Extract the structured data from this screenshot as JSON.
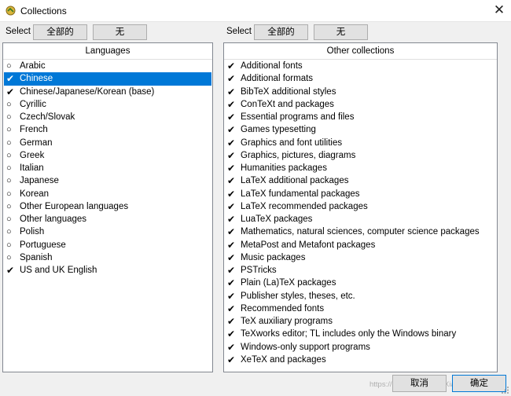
{
  "window": {
    "title": "Collections",
    "close_symbol": "✕"
  },
  "left_panel": {
    "select_label": "Select",
    "select_all": "全部的",
    "select_none": "无",
    "header": "Languages",
    "items": [
      {
        "label": "Arabic",
        "checked": false,
        "selected": false
      },
      {
        "label": "Chinese",
        "checked": true,
        "selected": true
      },
      {
        "label": "Chinese/Japanese/Korean (base)",
        "checked": true,
        "selected": false
      },
      {
        "label": "Cyrillic",
        "checked": false,
        "selected": false
      },
      {
        "label": "Czech/Slovak",
        "checked": false,
        "selected": false
      },
      {
        "label": "French",
        "checked": false,
        "selected": false
      },
      {
        "label": "German",
        "checked": false,
        "selected": false
      },
      {
        "label": "Greek",
        "checked": false,
        "selected": false
      },
      {
        "label": "Italian",
        "checked": false,
        "selected": false
      },
      {
        "label": "Japanese",
        "checked": false,
        "selected": false
      },
      {
        "label": "Korean",
        "checked": false,
        "selected": false
      },
      {
        "label": "Other European languages",
        "checked": false,
        "selected": false
      },
      {
        "label": "Other languages",
        "checked": false,
        "selected": false
      },
      {
        "label": "Polish",
        "checked": false,
        "selected": false
      },
      {
        "label": "Portuguese",
        "checked": false,
        "selected": false
      },
      {
        "label": "Spanish",
        "checked": false,
        "selected": false
      },
      {
        "label": "US and UK English",
        "checked": true,
        "selected": false
      }
    ]
  },
  "right_panel": {
    "select_label": "Select",
    "select_all": "全部的",
    "select_none": "无",
    "header": "Other collections",
    "items": [
      {
        "label": "Additional fonts",
        "checked": true,
        "selected": false
      },
      {
        "label": "Additional formats",
        "checked": true,
        "selected": false
      },
      {
        "label": "BibTeX additional styles",
        "checked": true,
        "selected": false
      },
      {
        "label": "ConTeXt and packages",
        "checked": true,
        "selected": false
      },
      {
        "label": "Essential programs and files",
        "checked": true,
        "selected": false
      },
      {
        "label": "Games typesetting",
        "checked": true,
        "selected": false
      },
      {
        "label": "Graphics and font utilities",
        "checked": true,
        "selected": false
      },
      {
        "label": "Graphics, pictures, diagrams",
        "checked": true,
        "selected": false
      },
      {
        "label": "Humanities packages",
        "checked": true,
        "selected": false
      },
      {
        "label": "LaTeX additional packages",
        "checked": true,
        "selected": false
      },
      {
        "label": "LaTeX fundamental packages",
        "checked": true,
        "selected": false
      },
      {
        "label": "LaTeX recommended packages",
        "checked": true,
        "selected": false
      },
      {
        "label": "LuaTeX packages",
        "checked": true,
        "selected": false
      },
      {
        "label": "Mathematics, natural sciences, computer science packages",
        "checked": true,
        "selected": false
      },
      {
        "label": "MetaPost and Metafont packages",
        "checked": true,
        "selected": false
      },
      {
        "label": "Music packages",
        "checked": true,
        "selected": false
      },
      {
        "label": "PSTricks",
        "checked": true,
        "selected": false
      },
      {
        "label": "Plain (La)TeX packages",
        "checked": true,
        "selected": false
      },
      {
        "label": "Publisher styles, theses, etc.",
        "checked": true,
        "selected": false
      },
      {
        "label": "Recommended fonts",
        "checked": true,
        "selected": false
      },
      {
        "label": "TeX auxiliary programs",
        "checked": true,
        "selected": false
      },
      {
        "label": "TeXworks editor; TL includes only the Windows binary",
        "checked": true,
        "selected": false
      },
      {
        "label": "Windows-only support programs",
        "checked": true,
        "selected": false
      },
      {
        "label": "XeTeX and packages",
        "checked": true,
        "selected": false
      }
    ]
  },
  "footer": {
    "cancel_label": "取消",
    "ok_label": "确定",
    "watermark": "https://blog.csdn.net/LiXiaoLiLiger"
  },
  "symbols": {
    "checked": "✔",
    "unchecked": "○"
  },
  "colors": {
    "selection": "#0078d7",
    "accent_border": "#0078d7"
  }
}
